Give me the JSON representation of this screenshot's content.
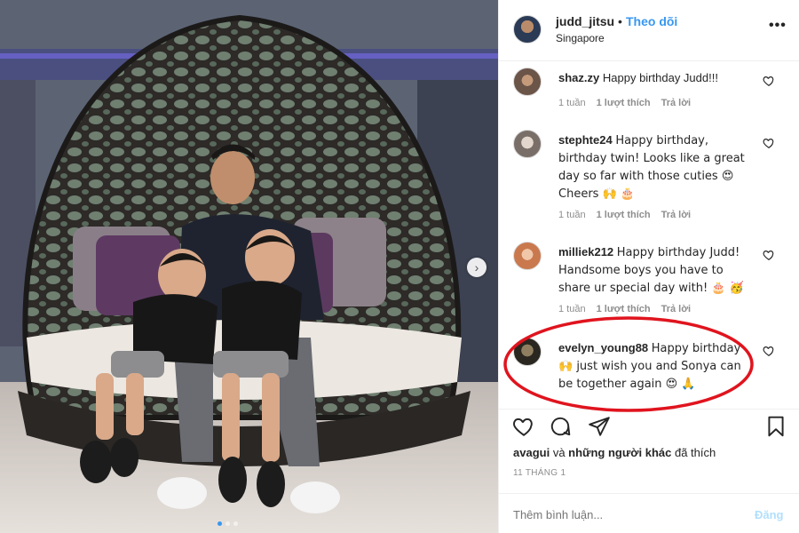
{
  "post": {
    "username": "judd_jitsu",
    "separator": "•",
    "follow_label": "Theo dõi",
    "location": "Singapore",
    "more_label": "..."
  },
  "comments": [
    {
      "username": "shaz.zy",
      "text": "Happy birthday Judd!!!",
      "time": "1 tuần",
      "likes": "1 lượt thích",
      "reply": "Trả lời"
    },
    {
      "username": "stephte24",
      "text": "Happy birthday, birthday twin! Looks like a great day so far with those cuties 😍 Cheers 🙌 🎂",
      "time": "1 tuần",
      "likes": "1 lượt thích",
      "reply": "Trả lời"
    },
    {
      "username": "milliek212",
      "text": "Happy birthday Judd! Handsome boys you have to share ur special day with! 🎂 🥳",
      "time": "1 tuần",
      "likes": "1 lượt thích",
      "reply": "Trả lời"
    },
    {
      "username": "evelyn_young88",
      "text": "Happy birthday 🙌 just wish you and Sonya can be together again 😍 🙏"
    }
  ],
  "liked_by": {
    "user": "avagui",
    "connector": "và",
    "others": "những người khác",
    "suffix": "đã thích"
  },
  "date": "11 THÁNG 1",
  "add_comment": {
    "placeholder": "Thêm bình luận...",
    "post_label": "Đăng"
  },
  "icons": {
    "like": "heart-icon",
    "comment": "comment-icon",
    "save": "bookmark-icon",
    "next": "chevron-right-icon"
  },
  "colors": {
    "link_blue": "#3897f0",
    "post_disabled": "#b2dffc",
    "secondary_text": "#8e8e8e",
    "annotation_red": "#e0141e"
  }
}
